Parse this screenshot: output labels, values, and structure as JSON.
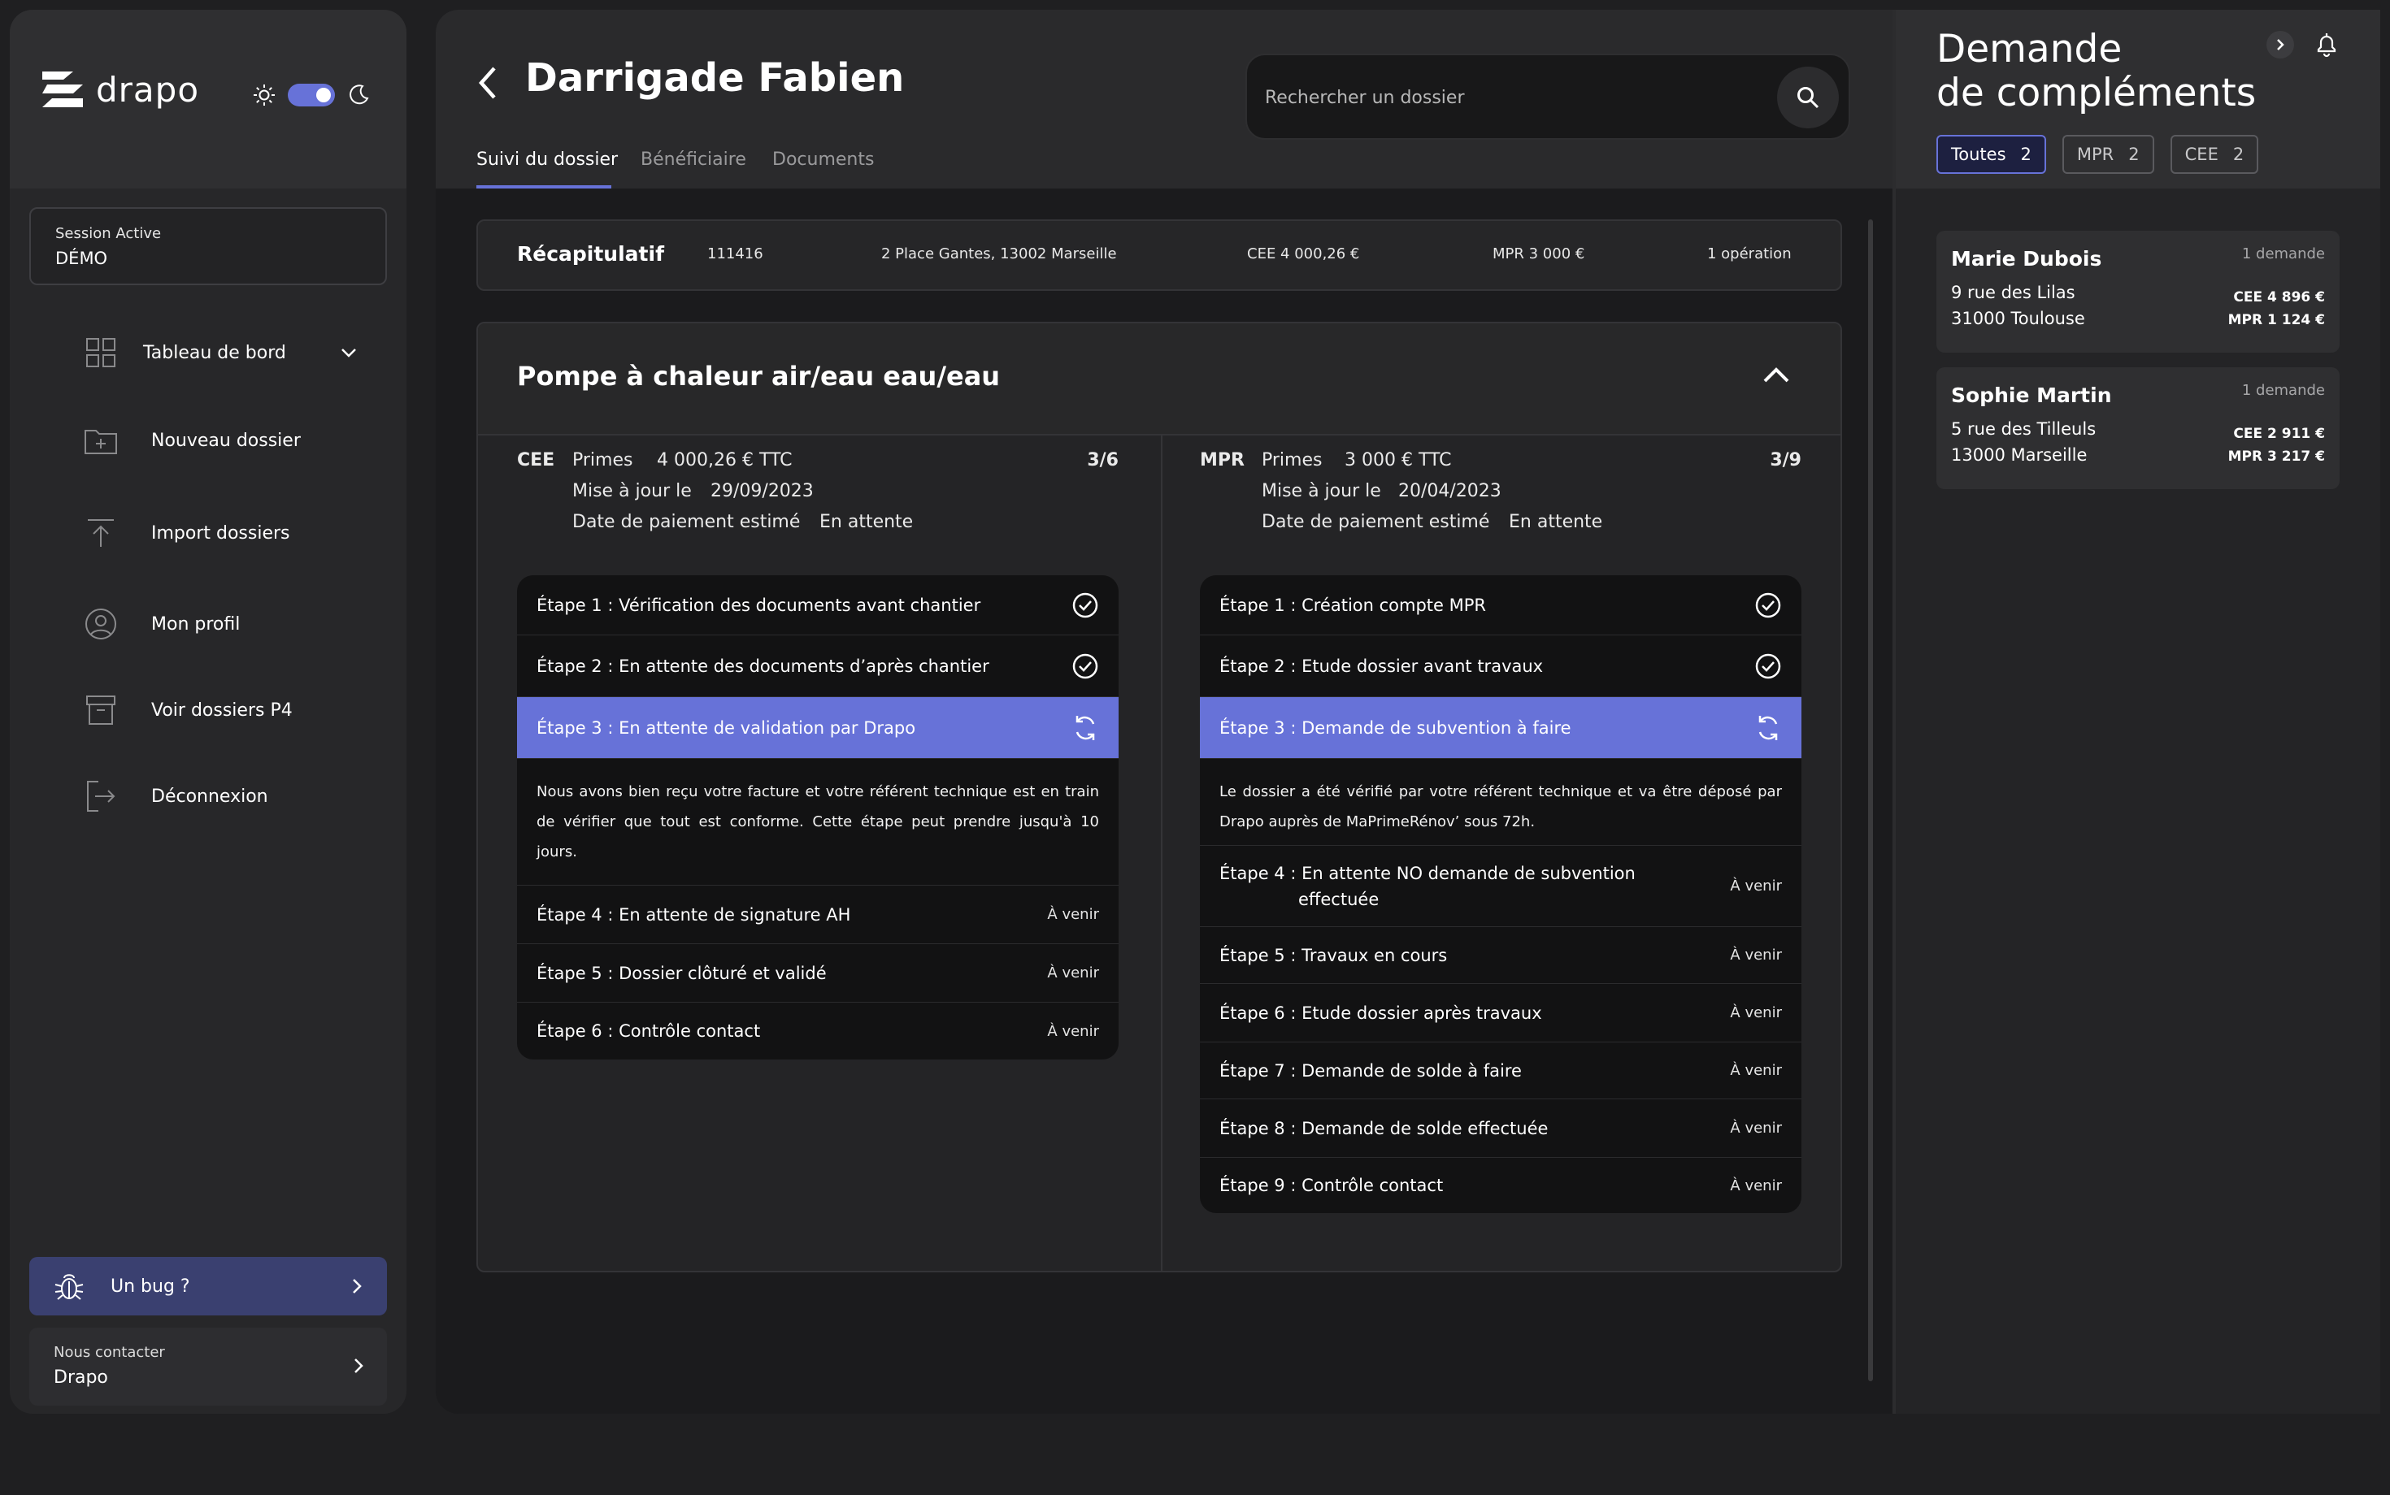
{
  "app": {
    "logo_text": "drapo"
  },
  "session": {
    "label": "Session Active",
    "value": "DÉMO"
  },
  "nav": [
    {
      "label": "Tableau de bord"
    },
    {
      "label": "Nouveau dossier"
    },
    {
      "label": "Import dossiers"
    },
    {
      "label": "Mon profil"
    },
    {
      "label": "Voir dossiers P4"
    },
    {
      "label": "Déconnexion"
    }
  ],
  "bug": {
    "label": "Un bug ?"
  },
  "contact": {
    "label": "Nous contacter",
    "value": "Drapo"
  },
  "header": {
    "title": "Darrigade Fabien",
    "search_placeholder": "Rechercher un dossier",
    "tabs": [
      "Suivi du dossier",
      "Bénéficiaire",
      "Documents"
    ]
  },
  "recap": {
    "title": "Récapitulatif",
    "id": "111416",
    "address": "2 Place Gantes, 13002 Marseille",
    "cee": "CEE 4 000,26 €",
    "mpr": "MPR 3 000 €",
    "ops": "1 opération"
  },
  "operation": {
    "title": "Pompe à chaleur air/eau eau/eau",
    "cee": {
      "program": "CEE",
      "primes_label": "Primes",
      "primes_value": "4 000,26 € TTC",
      "count": "3/6",
      "maj_label": "Mise à jour le",
      "maj_value": "29/09/2023",
      "paiement_label": "Date de paiement estimé",
      "paiement_value": "En attente",
      "steps": [
        {
          "label": "Étape 1 : Vérification des documents avant chantier"
        },
        {
          "label": "Étape 2 : En attente des documents d’après chantier"
        },
        {
          "label": "Étape 3 : En attente de validation par Drapo"
        },
        {
          "label": "Étape 4 : En attente de signature AH",
          "status": "À venir"
        },
        {
          "label": "Étape 5 : Dossier clôturé et validé",
          "status": "À venir"
        },
        {
          "label": "Étape 6 : Contrôle contact",
          "status": "À venir"
        }
      ],
      "active_desc": "Nous avons bien reçu votre facture et votre référent technique est en train de vérifier que tout est conforme. Cette étape peut prendre jusqu'à 10 jours."
    },
    "mpr": {
      "program": "MPR",
      "primes_label": "Primes",
      "primes_value": "3 000 € TTC",
      "count": "3/9",
      "maj_label": "Mise à jour le",
      "maj_value": "20/04/2023",
      "paiement_label": "Date de paiement estimé",
      "paiement_value": "En attente",
      "steps": [
        {
          "label": "Étape 1 : Création compte MPR"
        },
        {
          "label": "Étape 2 : Etude dossier avant travaux"
        },
        {
          "label": "Étape 3 : Demande de subvention à faire"
        },
        {
          "label": "Étape 4 : En attente NO demande de subvention",
          "label2": "effectuée",
          "status": "À venir"
        },
        {
          "label": "Étape 5 : Travaux en cours",
          "status": "À venir"
        },
        {
          "label": "Étape 6 : Etude dossier après travaux",
          "status": "À venir"
        },
        {
          "label": "Étape 7 : Demande de solde à faire",
          "status": "À venir"
        },
        {
          "label": "Étape 8 : Demande de solde effectuée",
          "status": "À venir"
        },
        {
          "label": "Étape 9 : Contrôle contact",
          "status": "À venir"
        }
      ],
      "active_desc": "Le dossier a été vérifié par votre référent technique et va être déposé par Drapo auprès de MaPrimeRénov’ sous 72h."
    }
  },
  "right_panel": {
    "title_line1": "Demande",
    "title_line2": "de compléments",
    "filters": [
      {
        "label": "Toutes",
        "count": "2"
      },
      {
        "label": "MPR",
        "count": "2"
      },
      {
        "label": "CEE",
        "count": "2"
      }
    ],
    "cards": [
      {
        "name": "Marie Dubois",
        "count": "1 demande",
        "addr1": "9 rue des Lilas",
        "addr2": "31000 Toulouse",
        "cee": "CEE 4 896 €",
        "mpr": "MPR 1 124 €"
      },
      {
        "name": "Sophie Martin",
        "count": "1 demande",
        "addr1": "5 rue des Tilleuls",
        "addr2": "13000 Marseille",
        "cee": "CEE 2 911 €",
        "mpr": "MPR 3 217 €"
      }
    ]
  },
  "colors": {
    "accent": "#6772d8",
    "background": "#1f1f21",
    "panel": "#272729"
  }
}
